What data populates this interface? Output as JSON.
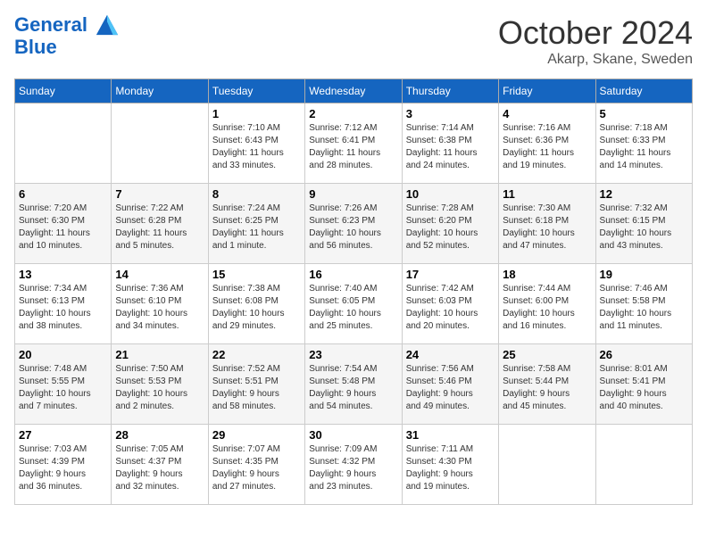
{
  "header": {
    "logo_line1": "General",
    "logo_line2": "Blue",
    "title": "October 2024",
    "subtitle": "Akarp, Skane, Sweden"
  },
  "weekdays": [
    "Sunday",
    "Monday",
    "Tuesday",
    "Wednesday",
    "Thursday",
    "Friday",
    "Saturday"
  ],
  "weeks": [
    [
      {
        "day": "",
        "info": ""
      },
      {
        "day": "",
        "info": ""
      },
      {
        "day": "1",
        "info": "Sunrise: 7:10 AM\nSunset: 6:43 PM\nDaylight: 11 hours\nand 33 minutes."
      },
      {
        "day": "2",
        "info": "Sunrise: 7:12 AM\nSunset: 6:41 PM\nDaylight: 11 hours\nand 28 minutes."
      },
      {
        "day": "3",
        "info": "Sunrise: 7:14 AM\nSunset: 6:38 PM\nDaylight: 11 hours\nand 24 minutes."
      },
      {
        "day": "4",
        "info": "Sunrise: 7:16 AM\nSunset: 6:36 PM\nDaylight: 11 hours\nand 19 minutes."
      },
      {
        "day": "5",
        "info": "Sunrise: 7:18 AM\nSunset: 6:33 PM\nDaylight: 11 hours\nand 14 minutes."
      }
    ],
    [
      {
        "day": "6",
        "info": "Sunrise: 7:20 AM\nSunset: 6:30 PM\nDaylight: 11 hours\nand 10 minutes."
      },
      {
        "day": "7",
        "info": "Sunrise: 7:22 AM\nSunset: 6:28 PM\nDaylight: 11 hours\nand 5 minutes."
      },
      {
        "day": "8",
        "info": "Sunrise: 7:24 AM\nSunset: 6:25 PM\nDaylight: 11 hours\nand 1 minute."
      },
      {
        "day": "9",
        "info": "Sunrise: 7:26 AM\nSunset: 6:23 PM\nDaylight: 10 hours\nand 56 minutes."
      },
      {
        "day": "10",
        "info": "Sunrise: 7:28 AM\nSunset: 6:20 PM\nDaylight: 10 hours\nand 52 minutes."
      },
      {
        "day": "11",
        "info": "Sunrise: 7:30 AM\nSunset: 6:18 PM\nDaylight: 10 hours\nand 47 minutes."
      },
      {
        "day": "12",
        "info": "Sunrise: 7:32 AM\nSunset: 6:15 PM\nDaylight: 10 hours\nand 43 minutes."
      }
    ],
    [
      {
        "day": "13",
        "info": "Sunrise: 7:34 AM\nSunset: 6:13 PM\nDaylight: 10 hours\nand 38 minutes."
      },
      {
        "day": "14",
        "info": "Sunrise: 7:36 AM\nSunset: 6:10 PM\nDaylight: 10 hours\nand 34 minutes."
      },
      {
        "day": "15",
        "info": "Sunrise: 7:38 AM\nSunset: 6:08 PM\nDaylight: 10 hours\nand 29 minutes."
      },
      {
        "day": "16",
        "info": "Sunrise: 7:40 AM\nSunset: 6:05 PM\nDaylight: 10 hours\nand 25 minutes."
      },
      {
        "day": "17",
        "info": "Sunrise: 7:42 AM\nSunset: 6:03 PM\nDaylight: 10 hours\nand 20 minutes."
      },
      {
        "day": "18",
        "info": "Sunrise: 7:44 AM\nSunset: 6:00 PM\nDaylight: 10 hours\nand 16 minutes."
      },
      {
        "day": "19",
        "info": "Sunrise: 7:46 AM\nSunset: 5:58 PM\nDaylight: 10 hours\nand 11 minutes."
      }
    ],
    [
      {
        "day": "20",
        "info": "Sunrise: 7:48 AM\nSunset: 5:55 PM\nDaylight: 10 hours\nand 7 minutes."
      },
      {
        "day": "21",
        "info": "Sunrise: 7:50 AM\nSunset: 5:53 PM\nDaylight: 10 hours\nand 2 minutes."
      },
      {
        "day": "22",
        "info": "Sunrise: 7:52 AM\nSunset: 5:51 PM\nDaylight: 9 hours\nand 58 minutes."
      },
      {
        "day": "23",
        "info": "Sunrise: 7:54 AM\nSunset: 5:48 PM\nDaylight: 9 hours\nand 54 minutes."
      },
      {
        "day": "24",
        "info": "Sunrise: 7:56 AM\nSunset: 5:46 PM\nDaylight: 9 hours\nand 49 minutes."
      },
      {
        "day": "25",
        "info": "Sunrise: 7:58 AM\nSunset: 5:44 PM\nDaylight: 9 hours\nand 45 minutes."
      },
      {
        "day": "26",
        "info": "Sunrise: 8:01 AM\nSunset: 5:41 PM\nDaylight: 9 hours\nand 40 minutes."
      }
    ],
    [
      {
        "day": "27",
        "info": "Sunrise: 7:03 AM\nSunset: 4:39 PM\nDaylight: 9 hours\nand 36 minutes."
      },
      {
        "day": "28",
        "info": "Sunrise: 7:05 AM\nSunset: 4:37 PM\nDaylight: 9 hours\nand 32 minutes."
      },
      {
        "day": "29",
        "info": "Sunrise: 7:07 AM\nSunset: 4:35 PM\nDaylight: 9 hours\nand 27 minutes."
      },
      {
        "day": "30",
        "info": "Sunrise: 7:09 AM\nSunset: 4:32 PM\nDaylight: 9 hours\nand 23 minutes."
      },
      {
        "day": "31",
        "info": "Sunrise: 7:11 AM\nSunset: 4:30 PM\nDaylight: 9 hours\nand 19 minutes."
      },
      {
        "day": "",
        "info": ""
      },
      {
        "day": "",
        "info": ""
      }
    ]
  ]
}
